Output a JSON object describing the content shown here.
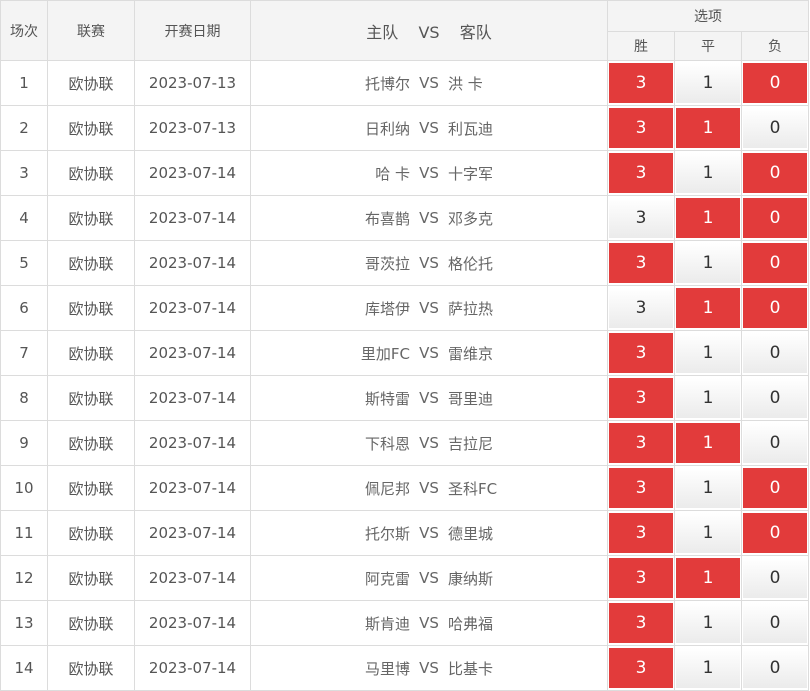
{
  "header": {
    "index": "场次",
    "league": "联赛",
    "date": "开赛日期",
    "home": "主队",
    "vs": "VS",
    "away": "客队",
    "options": "选项",
    "win": "胜",
    "draw": "平",
    "loss": "负"
  },
  "colors": {
    "selected": "#e23b3b",
    "border": "#dcdcdc",
    "header_bg": "#f4f4f4"
  },
  "rows": [
    {
      "index": "1",
      "league": "欧协联",
      "date": "2023-07-13",
      "home": "托博尔",
      "vs": "VS",
      "away": "洪 卡",
      "win": "3",
      "draw": "1",
      "loss": "0",
      "win_sel": true,
      "draw_sel": false,
      "loss_sel": true
    },
    {
      "index": "2",
      "league": "欧协联",
      "date": "2023-07-13",
      "home": "日利纳",
      "vs": "VS",
      "away": "利瓦迪",
      "win": "3",
      "draw": "1",
      "loss": "0",
      "win_sel": true,
      "draw_sel": true,
      "loss_sel": false
    },
    {
      "index": "3",
      "league": "欧协联",
      "date": "2023-07-14",
      "home": "哈 卡",
      "vs": "VS",
      "away": "十字军",
      "win": "3",
      "draw": "1",
      "loss": "0",
      "win_sel": true,
      "draw_sel": false,
      "loss_sel": true
    },
    {
      "index": "4",
      "league": "欧协联",
      "date": "2023-07-14",
      "home": "布喜鹊",
      "vs": "VS",
      "away": "邓多克",
      "win": "3",
      "draw": "1",
      "loss": "0",
      "win_sel": false,
      "draw_sel": true,
      "loss_sel": true
    },
    {
      "index": "5",
      "league": "欧协联",
      "date": "2023-07-14",
      "home": "哥茨拉",
      "vs": "VS",
      "away": "格伦托",
      "win": "3",
      "draw": "1",
      "loss": "0",
      "win_sel": true,
      "draw_sel": false,
      "loss_sel": true
    },
    {
      "index": "6",
      "league": "欧协联",
      "date": "2023-07-14",
      "home": "库塔伊",
      "vs": "VS",
      "away": "萨拉热",
      "win": "3",
      "draw": "1",
      "loss": "0",
      "win_sel": false,
      "draw_sel": true,
      "loss_sel": true
    },
    {
      "index": "7",
      "league": "欧协联",
      "date": "2023-07-14",
      "home": "里加FC",
      "vs": "VS",
      "away": "雷维京",
      "win": "3",
      "draw": "1",
      "loss": "0",
      "win_sel": true,
      "draw_sel": false,
      "loss_sel": false
    },
    {
      "index": "8",
      "league": "欧协联",
      "date": "2023-07-14",
      "home": "斯特雷",
      "vs": "VS",
      "away": "哥里迪",
      "win": "3",
      "draw": "1",
      "loss": "0",
      "win_sel": true,
      "draw_sel": false,
      "loss_sel": false
    },
    {
      "index": "9",
      "league": "欧协联",
      "date": "2023-07-14",
      "home": "下科恩",
      "vs": "VS",
      "away": "吉拉尼",
      "win": "3",
      "draw": "1",
      "loss": "0",
      "win_sel": true,
      "draw_sel": true,
      "loss_sel": false
    },
    {
      "index": "10",
      "league": "欧协联",
      "date": "2023-07-14",
      "home": "佩尼邦",
      "vs": "VS",
      "away": "圣科FC",
      "win": "3",
      "draw": "1",
      "loss": "0",
      "win_sel": true,
      "draw_sel": false,
      "loss_sel": true
    },
    {
      "index": "11",
      "league": "欧协联",
      "date": "2023-07-14",
      "home": "托尔斯",
      "vs": "VS",
      "away": "德里城",
      "win": "3",
      "draw": "1",
      "loss": "0",
      "win_sel": true,
      "draw_sel": false,
      "loss_sel": true
    },
    {
      "index": "12",
      "league": "欧协联",
      "date": "2023-07-14",
      "home": "阿克雷",
      "vs": "VS",
      "away": "康纳斯",
      "win": "3",
      "draw": "1",
      "loss": "0",
      "win_sel": true,
      "draw_sel": true,
      "loss_sel": false
    },
    {
      "index": "13",
      "league": "欧协联",
      "date": "2023-07-14",
      "home": "斯肯迪",
      "vs": "VS",
      "away": "哈弗福",
      "win": "3",
      "draw": "1",
      "loss": "0",
      "win_sel": true,
      "draw_sel": false,
      "loss_sel": false
    },
    {
      "index": "14",
      "league": "欧协联",
      "date": "2023-07-14",
      "home": "马里博",
      "vs": "VS",
      "away": "比基卡",
      "win": "3",
      "draw": "1",
      "loss": "0",
      "win_sel": true,
      "draw_sel": false,
      "loss_sel": false
    }
  ]
}
